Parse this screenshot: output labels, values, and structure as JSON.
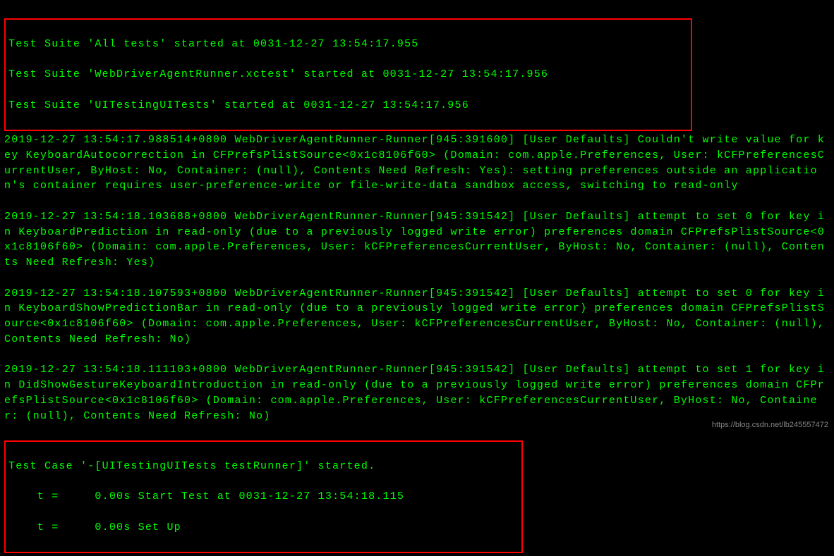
{
  "terminal": {
    "box1": {
      "line1": "Test Suite 'All tests' started at 0031-12-27 13:54:17.955",
      "line2": "Test Suite 'WebDriverAgentRunner.xctest' started at 0031-12-27 13:54:17.956",
      "line3": "Test Suite 'UITestingUITests' started at 0031-12-27 13:54:17.956"
    },
    "body": {
      "line1": "2019-12-27 13:54:17.988514+0800 WebDriverAgentRunner-Runner[945:391600] [User Defaults] Couldn't write value for key KeyboardAutocorrection in CFPrefsPlistSource<0x1c8106f60> (Domain: com.apple.Preferences, User: kCFPreferencesCurrentUser, ByHost: No, Container: (null), Contents Need Refresh: Yes): setting preferences outside an application's container requires user-preference-write or file-write-data sandbox access, switching to read-only",
      "line2": "2019-12-27 13:54:18.103688+0800 WebDriverAgentRunner-Runner[945:391542] [User Defaults] attempt to set 0 for key in KeyboardPrediction in read-only (due to a previously logged write error) preferences domain CFPrefsPlistSource<0x1c8106f60> (Domain: com.apple.Preferences, User: kCFPreferencesCurrentUser, ByHost: No, Container: (null), Contents Need Refresh: Yes)",
      "line3": "2019-12-27 13:54:18.107593+0800 WebDriverAgentRunner-Runner[945:391542] [User Defaults] attempt to set 0 for key in KeyboardShowPredictionBar in read-only (due to a previously logged write error) preferences domain CFPrefsPlistSource<0x1c8106f60> (Domain: com.apple.Preferences, User: kCFPreferencesCurrentUser, ByHost: No, Container: (null), Contents Need Refresh: No)",
      "line4": "2019-12-27 13:54:18.111103+0800 WebDriverAgentRunner-Runner[945:391542] [User Defaults] attempt to set 1 for key in DidShowGestureKeyboardIntroduction in read-only (due to a previously logged write error) preferences domain CFPrefsPlistSource<0x1c8106f60> (Domain: com.apple.Preferences, User: kCFPreferencesCurrentUser, ByHost: No, Container: (null), Contents Need Refresh: No)"
    },
    "box2": {
      "line1": "Test Case '-[UITestingUITests testRunner]' started.",
      "line2": "    t =     0.00s Start Test at 0031-12-27 13:54:18.115",
      "line3": "    t =     0.00s Set Up"
    }
  },
  "watermark": "https://blog.csdn.net/lb245557472"
}
